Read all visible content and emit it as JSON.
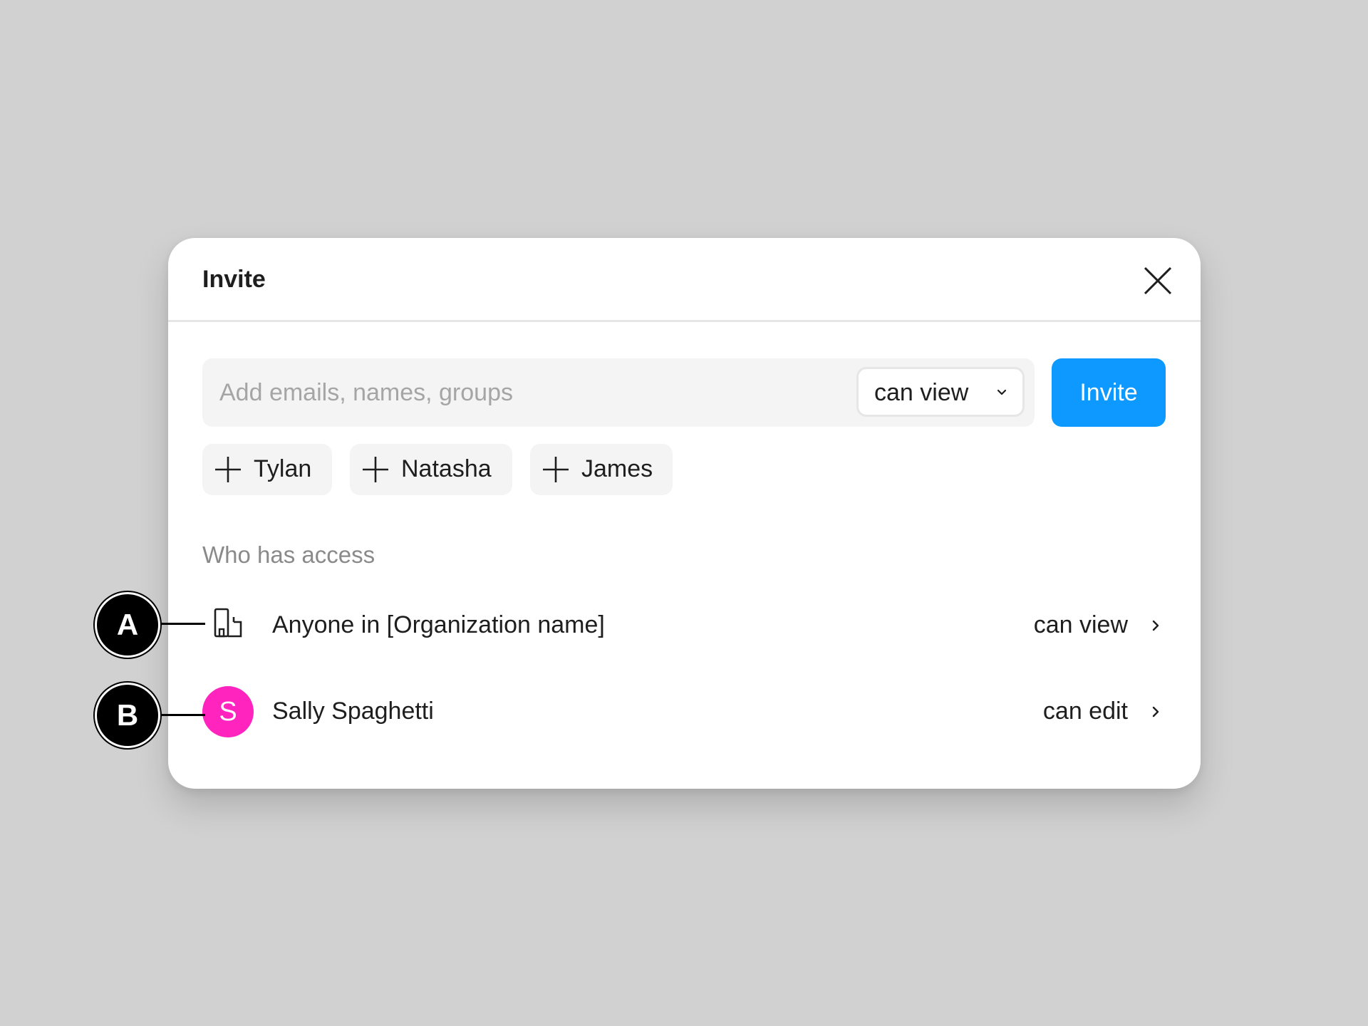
{
  "dialog": {
    "title": "Invite",
    "search": {
      "placeholder": "Add emails, names, groups",
      "value": ""
    },
    "permission_select": {
      "selected": "can view"
    },
    "invite_button": "Invite",
    "suggestions": [
      {
        "label": "Tylan"
      },
      {
        "label": "Natasha"
      },
      {
        "label": "James"
      }
    ],
    "access_section": {
      "label": "Who has access",
      "rows": [
        {
          "name": "Anyone in [Organization name]",
          "permission": "can view",
          "icon": "organization-icon"
        },
        {
          "name": "Sally Spaghetti",
          "permission": "can edit",
          "avatar_initial": "S",
          "avatar_color": "#ff24bd"
        }
      ]
    }
  },
  "callouts": {
    "a": "A",
    "b": "B"
  },
  "colors": {
    "accent": "#0d99ff",
    "background": "#d1d1d1",
    "chip_background": "#f4f4f4"
  }
}
